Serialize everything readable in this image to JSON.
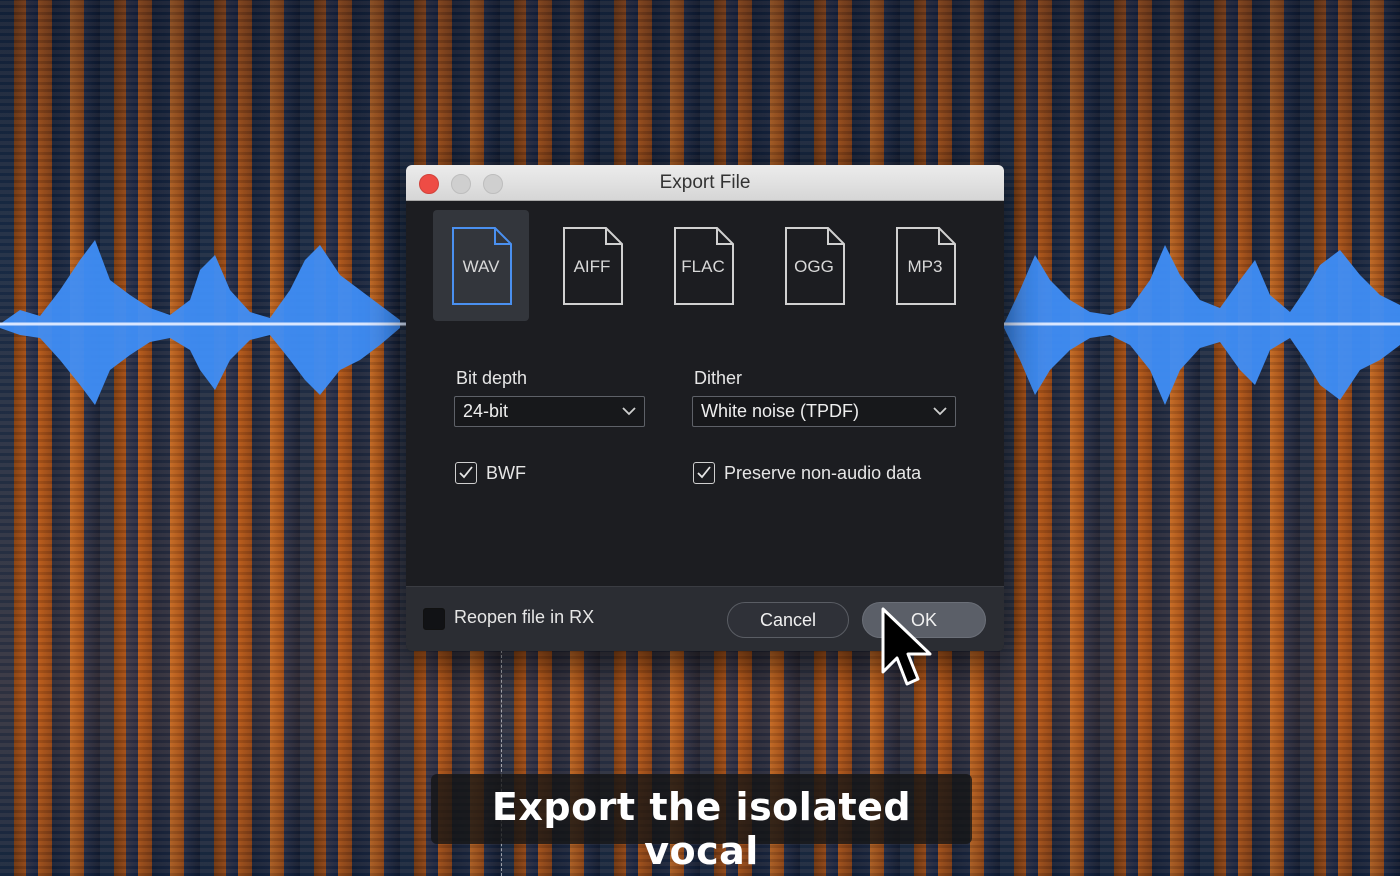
{
  "dialog": {
    "title": "Export File",
    "formats": [
      {
        "label": "WAV",
        "selected": true
      },
      {
        "label": "AIFF",
        "selected": false
      },
      {
        "label": "FLAC",
        "selected": false
      },
      {
        "label": "OGG",
        "selected": false
      },
      {
        "label": "MP3",
        "selected": false
      }
    ],
    "bit_depth": {
      "label": "Bit depth",
      "value": "24-bit"
    },
    "dither": {
      "label": "Dither",
      "value": "White noise (TPDF)"
    },
    "bwf": {
      "label": "BWF",
      "checked": true
    },
    "preserve": {
      "label": "Preserve non-audio data",
      "checked": true
    },
    "reopen": {
      "label": "Reopen file in RX",
      "checked": false
    },
    "cancel_label": "Cancel",
    "ok_label": "OK"
  },
  "caption": "Export the isolated vocal",
  "colors": {
    "waveform": "#3f8ef7",
    "spectrogram_hot": "#d9781f",
    "spectrogram_cold": "#14264a",
    "selected_format": "#4a90f0",
    "close_button": "#ee4c45"
  },
  "icons": {
    "file": "file-icon",
    "chevron": "chevron-down-icon",
    "check": "checkmark-icon",
    "cursor": "mouse-pointer-icon"
  }
}
